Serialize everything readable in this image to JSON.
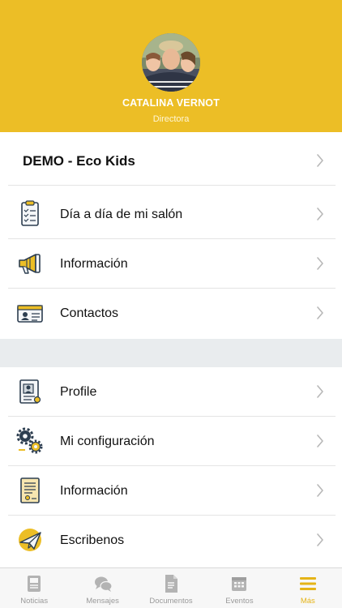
{
  "theme": {
    "accent": "#ECBE26",
    "tab_inactive": "#9a9a9a"
  },
  "profile": {
    "name": "CATALINA VERNOT",
    "role": "Directora"
  },
  "school": {
    "label": "DEMO - Eco Kids"
  },
  "menu_section_1": [
    {
      "label": "Día a día de mi salón",
      "icon": "checklist-icon"
    },
    {
      "label": "Información",
      "icon": "megaphone-icon"
    },
    {
      "label": "Contactos",
      "icon": "contact-card-icon"
    }
  ],
  "menu_section_2": [
    {
      "label": "Profile",
      "icon": "profile-document-icon"
    },
    {
      "label": "Mi configuración",
      "icon": "gears-icon"
    },
    {
      "label": "Información",
      "icon": "certificate-icon"
    },
    {
      "label": "Escribenos",
      "icon": "paper-plane-icon"
    }
  ],
  "tabbar": [
    {
      "label": "Noticias",
      "icon": "news-icon",
      "active": false
    },
    {
      "label": "Mensajes",
      "icon": "chat-icon",
      "active": false
    },
    {
      "label": "Documentos",
      "icon": "document-icon",
      "active": false
    },
    {
      "label": "Eventos",
      "icon": "calendar-icon",
      "active": false
    },
    {
      "label": "Más",
      "icon": "menu-icon",
      "active": true
    }
  ]
}
